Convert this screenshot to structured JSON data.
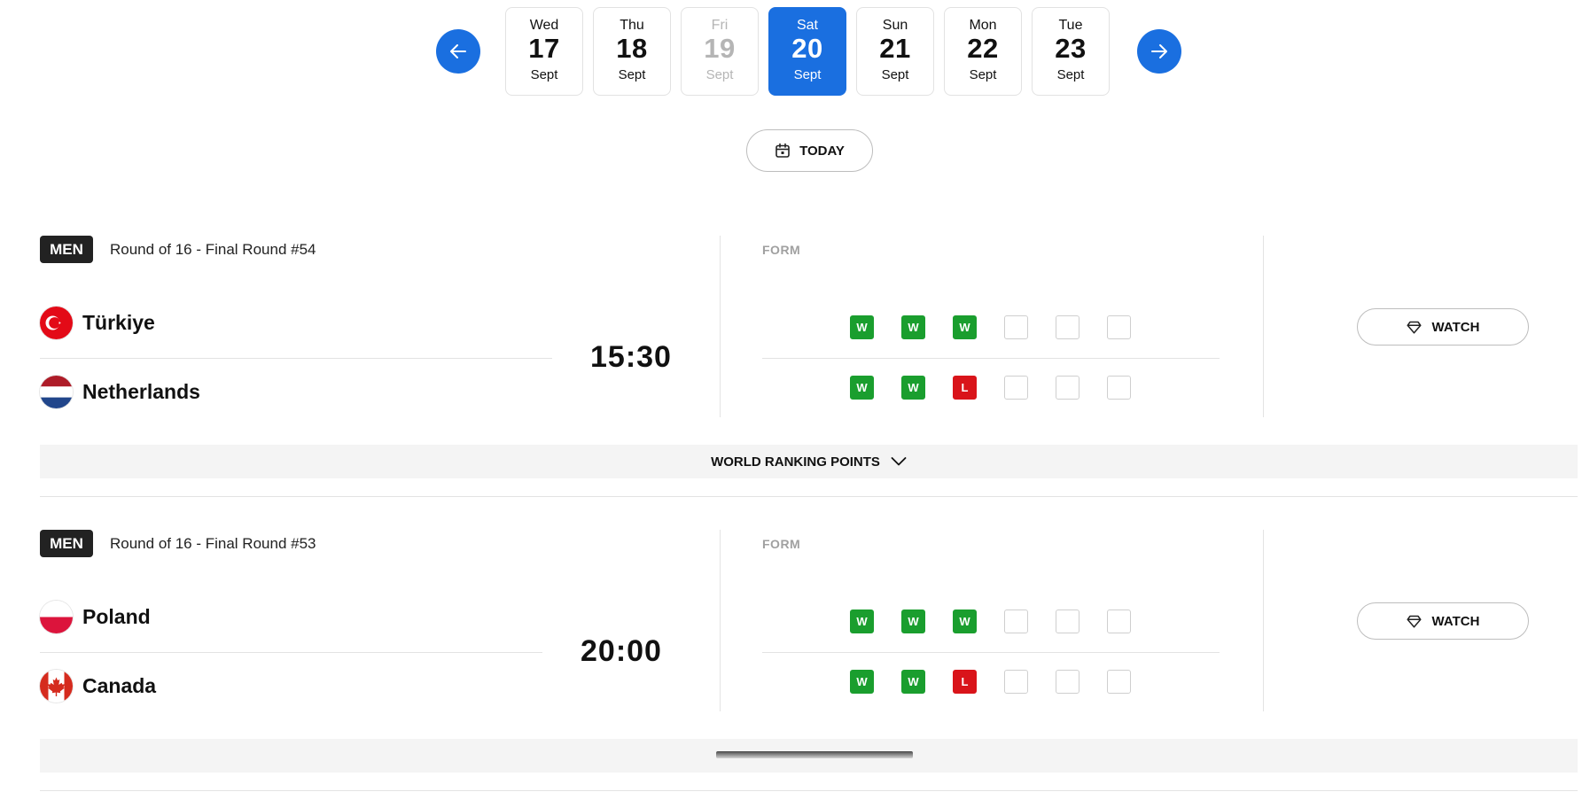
{
  "date_nav": {
    "prev_icon": "arrow-left-icon",
    "next_icon": "arrow-right-icon",
    "dates": [
      {
        "dow": "Wed",
        "day": "17",
        "month": "Sept",
        "state": "normal"
      },
      {
        "dow": "Thu",
        "day": "18",
        "month": "Sept",
        "state": "normal"
      },
      {
        "dow": "Fri",
        "day": "19",
        "month": "Sept",
        "state": "disabled"
      },
      {
        "dow": "Sat",
        "day": "20",
        "month": "Sept",
        "state": "selected"
      },
      {
        "dow": "Sun",
        "day": "21",
        "month": "Sept",
        "state": "normal"
      },
      {
        "dow": "Mon",
        "day": "22",
        "month": "Sept",
        "state": "normal"
      },
      {
        "dow": "Tue",
        "day": "23",
        "month": "Sept",
        "state": "normal"
      }
    ],
    "today_label": "TODAY",
    "today_icon": "calendar-icon"
  },
  "matches": [
    {
      "category": "MEN",
      "round": "Round of 16 - Final Round #54",
      "time": "15:30",
      "form_label": "FORM",
      "watch_label": "WATCH",
      "watch_icon": "diamond-icon",
      "home": {
        "name": "Türkiye",
        "flag": "turkey-flag",
        "form": [
          "W",
          "W",
          "W",
          "",
          "",
          ""
        ]
      },
      "away": {
        "name": "Netherlands",
        "flag": "netherlands-flag",
        "form": [
          "W",
          "W",
          "L",
          "",
          "",
          ""
        ]
      },
      "ranking_label": "WORLD RANKING POINTS",
      "ranking_icon": "chevron-down-icon"
    },
    {
      "category": "MEN",
      "round": "Round of 16 - Final Round #53",
      "time": "20:00",
      "form_label": "FORM",
      "watch_label": "WATCH",
      "watch_icon": "diamond-icon",
      "home": {
        "name": "Poland",
        "flag": "poland-flag",
        "form": [
          "W",
          "W",
          "W",
          "",
          "",
          ""
        ]
      },
      "away": {
        "name": "Canada",
        "flag": "canada-flag",
        "form": [
          "W",
          "W",
          "L",
          "",
          "",
          ""
        ]
      },
      "ranking_label": "",
      "ranking_icon": ""
    }
  ],
  "colors": {
    "accent": "#1a6fe0",
    "win": "#1a9e2e",
    "loss": "#d9141a",
    "badge": "#222222"
  }
}
